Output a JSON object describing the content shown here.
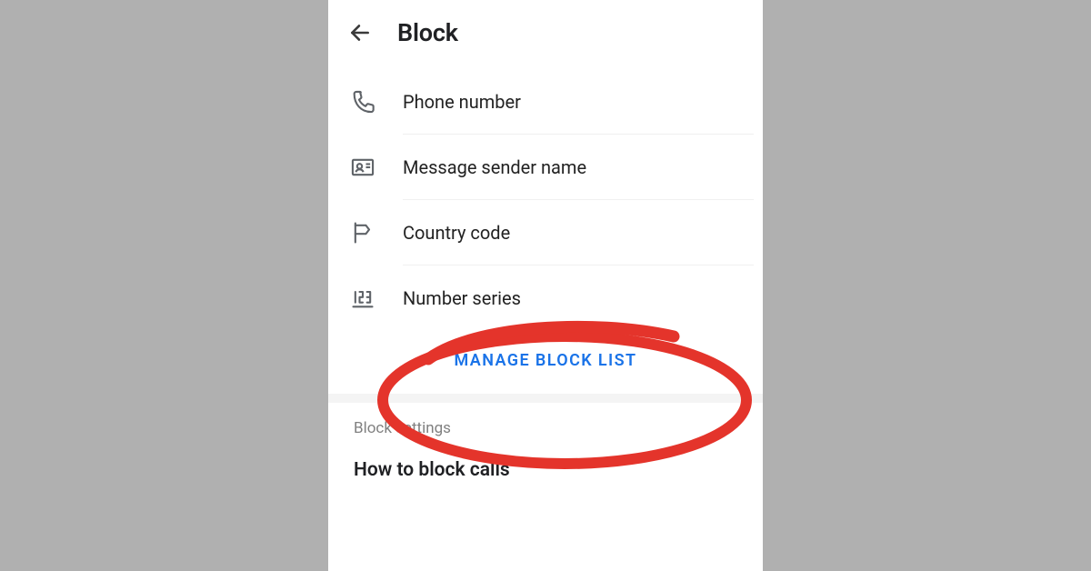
{
  "header": {
    "title": "Block"
  },
  "block_options": [
    {
      "icon": "phone-icon",
      "label": "Phone number"
    },
    {
      "icon": "contact-card-icon",
      "label": "Message sender name"
    },
    {
      "icon": "flag-icon",
      "label": "Country code"
    },
    {
      "icon": "number-series-icon",
      "label": "Number series"
    }
  ],
  "manage_link_label": "MANAGE BLOCK LIST",
  "sections": {
    "block_settings_header": "Block settings",
    "how_to_block_calls": "How to block calls"
  }
}
